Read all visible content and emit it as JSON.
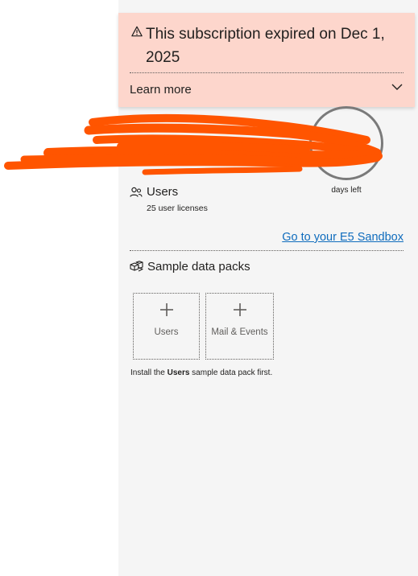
{
  "banner": {
    "message": "This subscription expired on Dec 1, 2025",
    "learn_more": "Learn more",
    "icon": "warning-icon",
    "background": "#fdd6cc"
  },
  "subscription": {
    "days_value": "0",
    "days_label": "days left"
  },
  "users": {
    "heading": "Users",
    "licenses": "25 user licenses",
    "icon": "users-icon"
  },
  "sandbox_link": "Go to your E5 Sandbox",
  "sample_data": {
    "heading": "Sample data packs",
    "icon": "packages-icon",
    "packs": [
      {
        "label": "Users"
      },
      {
        "label": "Mail & Events"
      }
    ],
    "note_prefix": "Install the ",
    "note_bold": "Users",
    "note_suffix": " sample data pack first."
  },
  "colors": {
    "link": "#0f6cbd",
    "days_value": "#b01818",
    "redaction": "#ff5500"
  }
}
